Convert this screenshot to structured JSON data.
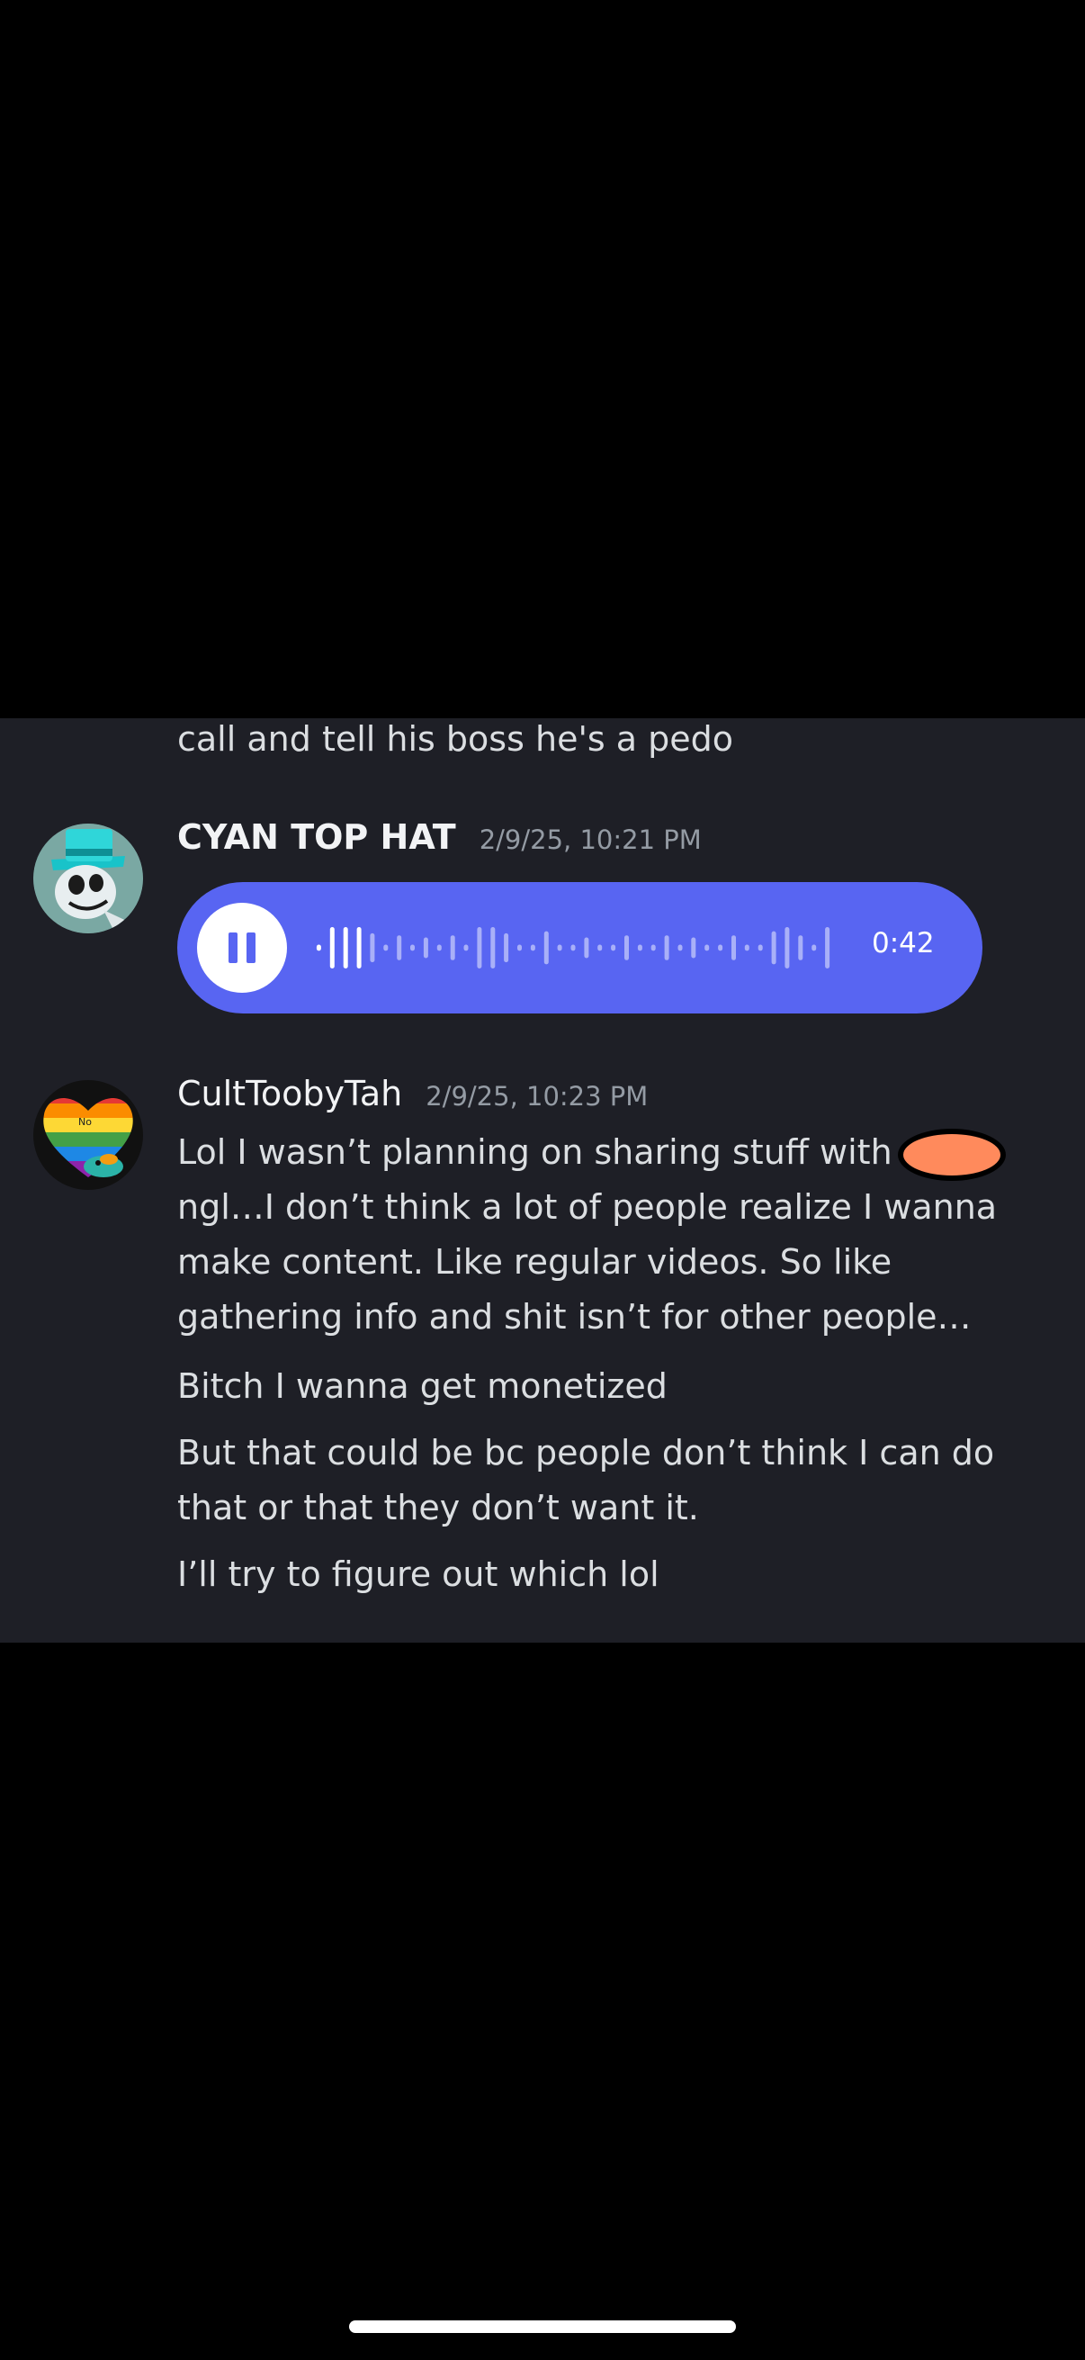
{
  "previous_message": {
    "text": "call and tell his boss he's a pedo"
  },
  "messages": [
    {
      "username": "CYAN TOP HAT",
      "timestamp": "2/9/25, 10:21 PM",
      "avatar_icon": "cyan-top-hat-cartoon-avatar",
      "voice_message": {
        "state": "playing",
        "play_button_icon": "pause-icon",
        "duration": "0:42",
        "accent_color": "#5865f2"
      }
    },
    {
      "username": "CultToobyTah",
      "timestamp": "2/9/25, 10:23 PM",
      "avatar_icon": "rainbow-heart-platypus-avatar",
      "paragraphs": [
        {
          "lines": [
            "Lol I wasn’t planning on sharing stuff with",
            "ngl…I don’t think a lot of people realize I wanna",
            "make content. Like regular videos. So like",
            "gathering info and shit isn’t for other people…"
          ]
        },
        {
          "lines": [
            "Bitch I wanna get monetized"
          ]
        },
        {
          "lines": [
            "But that could be bc people don’t think I can do",
            "that or that they don’t want it."
          ]
        },
        {
          "lines": [
            "I’ll try to figure out which lol"
          ]
        }
      ]
    }
  ],
  "colors": {
    "background": "#000000",
    "chat_background": "#1e1f26",
    "username": "#f2f3f5",
    "timestamp": "#949ba4",
    "message_text": "#dbdee1",
    "redaction_scribble": "#ff8a5c"
  }
}
